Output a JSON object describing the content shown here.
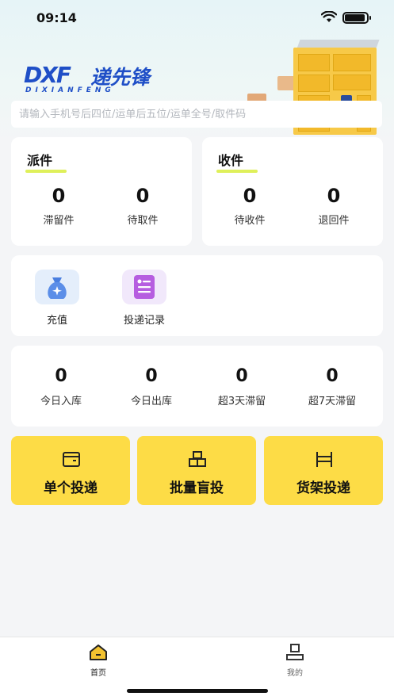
{
  "status_bar": {
    "time": "09:14"
  },
  "logo": {
    "mark": "DXF",
    "name": "递先锋",
    "subtitle": "DIXIANFENG"
  },
  "search": {
    "placeholder": "请输入手机号后四位/运单后五位/运单全号/取件码"
  },
  "dispatch": {
    "title": "派件",
    "stats": [
      {
        "value": "0",
        "label": "滞留件"
      },
      {
        "value": "0",
        "label": "待取件"
      }
    ]
  },
  "receive": {
    "title": "收件",
    "stats": [
      {
        "value": "0",
        "label": "待收件"
      },
      {
        "value": "0",
        "label": "退回件"
      }
    ]
  },
  "tools": [
    {
      "label": "充值",
      "icon": "money-bag-icon"
    },
    {
      "label": "投递记录",
      "icon": "record-card-icon"
    }
  ],
  "daily_stats": [
    {
      "value": "0",
      "label": "今日入库"
    },
    {
      "value": "0",
      "label": "今日出库"
    },
    {
      "value": "0",
      "label": "超3天滞留"
    },
    {
      "value": "0",
      "label": "超7天滞留"
    }
  ],
  "actions": [
    {
      "label": "单个投递",
      "icon": "parcel-icon"
    },
    {
      "label": "批量盲投",
      "icon": "stacked-boxes-icon"
    },
    {
      "label": "货架投递",
      "icon": "shelf-icon"
    }
  ],
  "tabbar": [
    {
      "label": "首页",
      "icon": "home-icon",
      "active": true
    },
    {
      "label": "我的",
      "icon": "person-icon",
      "active": false
    }
  ],
  "colors": {
    "accent": "#fddc46",
    "underline": "#dff05a",
    "brand": "#1f4fc7",
    "active_tab": "#f2c230"
  }
}
